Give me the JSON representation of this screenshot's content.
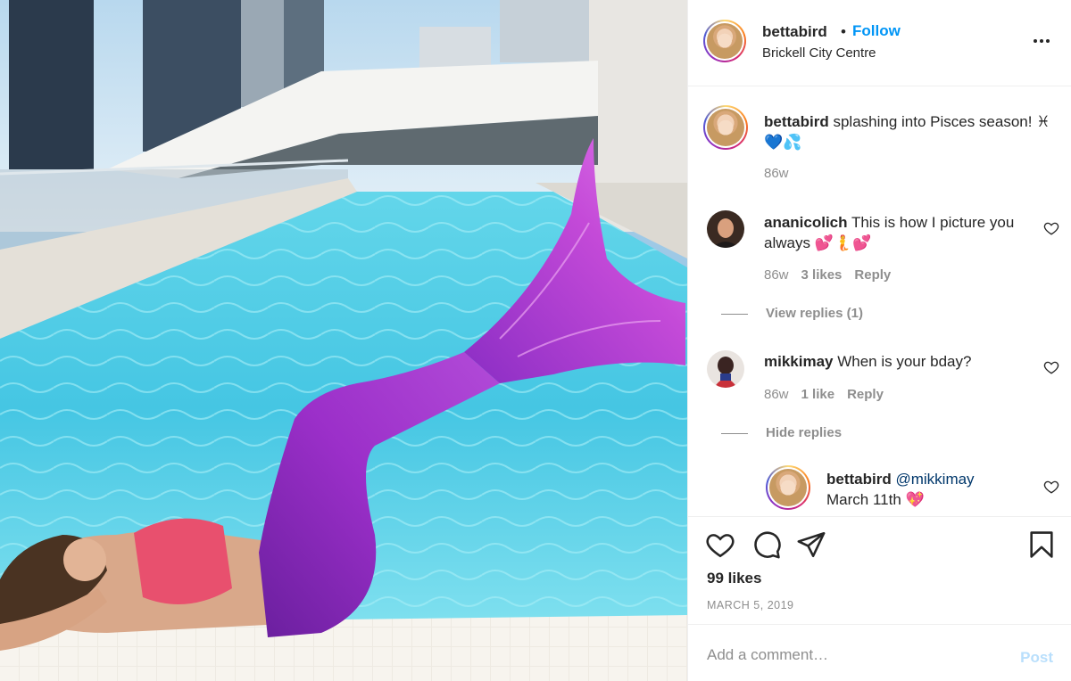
{
  "post": {
    "image_alt": "Woman in purple mermaid tail and pink top lying at the edge of a rooftop swimming pool",
    "colors": {
      "tail": "#9b2fc9",
      "fin": "#c23fd6",
      "pool": "#5fd1e6",
      "top": "#e8506e"
    }
  },
  "header": {
    "username": "bettabird",
    "dot": "•",
    "follow_label": "Follow",
    "location": "Brickell City Centre",
    "more_icon": "ellipsis-icon"
  },
  "caption": {
    "username": "bettabird",
    "text": " splashing into Pisces season! ♓ 💙💦",
    "time": "86w"
  },
  "comments": [
    {
      "username": "ananicolich",
      "text": " This is how I picture you always 💕🧜💕",
      "time": "86w",
      "likes": "3 likes",
      "reply_label": "Reply",
      "replies_toggle": "View replies (1)"
    },
    {
      "username": "mikkimay",
      "text": " When is your bday?",
      "time": "86w",
      "likes": "1 like",
      "reply_label": "Reply",
      "replies_toggle": "Hide replies",
      "replies": [
        {
          "username": "bettabird",
          "mention": "@mikkimay",
          "text": "March 11th 💖"
        }
      ]
    }
  ],
  "actions": {
    "like_icon": "heart-icon",
    "comment_icon": "comment-icon",
    "share_icon": "paper-plane-icon",
    "save_icon": "bookmark-icon",
    "likes": "99 likes",
    "date": "MARCH 5, 2019"
  },
  "add_comment": {
    "placeholder": "Add a comment…",
    "post_label": "Post"
  },
  "colors": {
    "link_blue": "#0095f6",
    "text": "#262626",
    "muted": "#8e8e8e",
    "post_disabled": "#b9dffc"
  }
}
